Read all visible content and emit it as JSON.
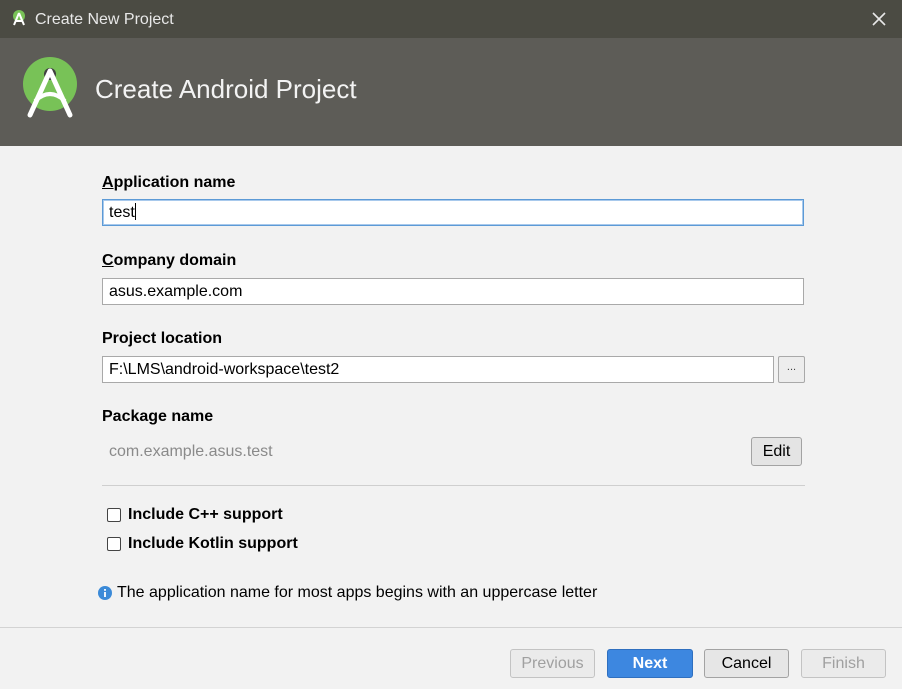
{
  "window": {
    "title": "Create New Project",
    "close_icon": "close-icon",
    "app_icon": "android-studio-icon"
  },
  "banner": {
    "heading": "Create Android Project",
    "logo_icon": "android-studio-logo-icon"
  },
  "form": {
    "app_name": {
      "label_mnemonic": "A",
      "label_rest": "pplication name",
      "value": "test"
    },
    "company_domain": {
      "label_mnemonic": "C",
      "label_rest": "ompany domain",
      "value": "asus.example.com"
    },
    "project_location": {
      "label": "Project location",
      "value": "F:\\LMS\\android-workspace\\test2",
      "browse_label": "..."
    },
    "package_name": {
      "label": "Package name",
      "value": "com.example.asus.test",
      "edit_label": "Edit"
    },
    "cpp_support": {
      "label": "Include C++ support",
      "checked": false
    },
    "kotlin_support": {
      "label": "Include Kotlin support",
      "checked": false
    },
    "hint": {
      "icon": "info-icon",
      "text": "The application name for most apps begins with an uppercase letter"
    }
  },
  "footer": {
    "previous_label": "Previous",
    "next_label": "Next",
    "cancel_label": "Cancel",
    "finish_label": "Finish"
  },
  "colors": {
    "titlebar": "#4b4b43",
    "banner": "#5d5c57",
    "accent": "#3d87e0",
    "logo_green": "#78c257"
  }
}
